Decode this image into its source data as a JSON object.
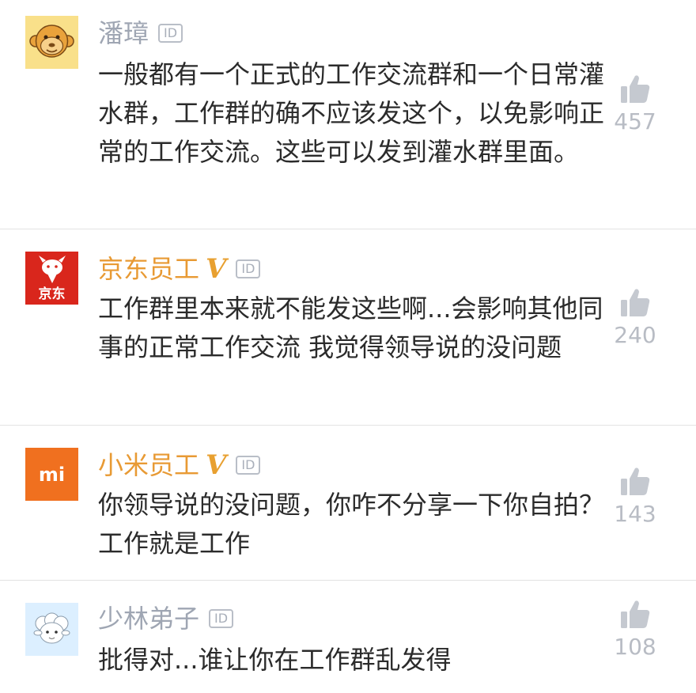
{
  "comments": [
    {
      "username": "潘璋",
      "user_style": "plain",
      "verified": false,
      "id_badge": "ID",
      "avatar_icon": "monkey-icon",
      "text": "一般都有一个正式的工作交流群和一个日常灌水群，工作群的确不应该发这个，以免影响正常的工作交流。这些可以发到灌水群里面。",
      "likes": "457"
    },
    {
      "username": "京东员工",
      "user_style": "org",
      "verified": true,
      "verified_mark": "V",
      "id_badge": "ID",
      "avatar_icon": "jd-dog-logo-icon",
      "avatar_text": "京东",
      "text": "工作群里本来就不能发这些啊...会影响其他同事的正常工作交流 我觉得领导说的没问题",
      "likes": "240"
    },
    {
      "username": "小米员工",
      "user_style": "org",
      "verified": true,
      "verified_mark": "V",
      "id_badge": "ID",
      "avatar_icon": "mi-logo-icon",
      "avatar_text": "mi",
      "text": "你领导说的没问题，你咋不分享一下你自拍？工作就是工作",
      "likes": "143"
    },
    {
      "username": "少林弟子",
      "user_style": "plain",
      "verified": false,
      "id_badge": "ID",
      "avatar_icon": "sheep-icon",
      "text": "批得对...谁让你在工作群乱发得",
      "likes": "108"
    }
  ],
  "colors": {
    "plain_name": "#9fa6b3",
    "org_name": "#e89a34",
    "jd_red": "#d9261c",
    "mi_orange": "#f0701f",
    "monkey_bg": "#f9e08a",
    "sheep_bg": "#dcefff"
  }
}
